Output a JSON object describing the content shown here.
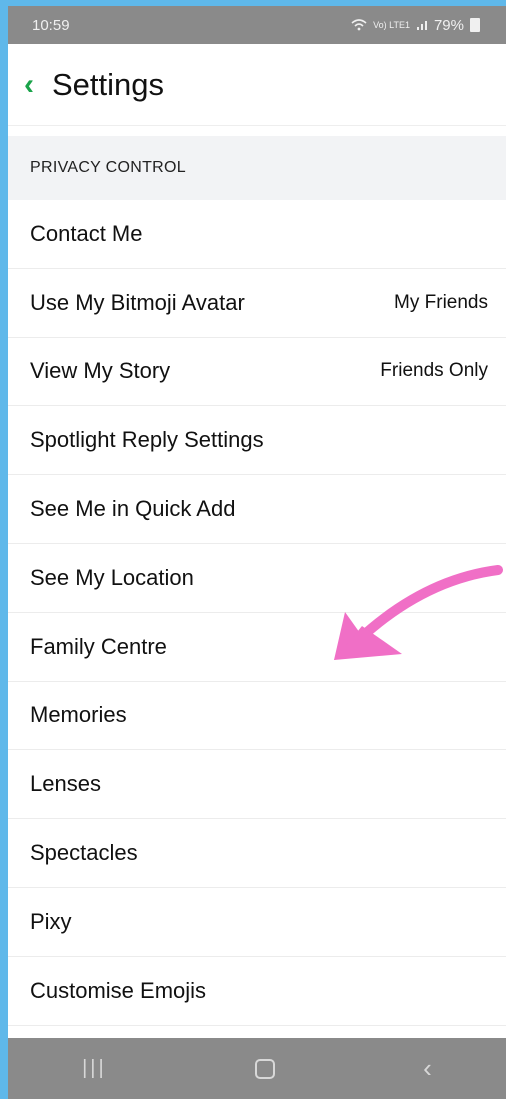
{
  "status_bar": {
    "time": "10:59",
    "network": "Vo) LTE1",
    "battery": "79%"
  },
  "header": {
    "back_icon": "chevron-left-icon",
    "title": "Settings"
  },
  "section": {
    "title": "PRIVACY CONTROL"
  },
  "rows": [
    {
      "label": "Contact Me",
      "value": ""
    },
    {
      "label": "Use My Bitmoji Avatar",
      "value": "My Friends"
    },
    {
      "label": "View My Story",
      "value": "Friends Only"
    },
    {
      "label": "Spotlight Reply Settings",
      "value": ""
    },
    {
      "label": "See Me in Quick Add",
      "value": ""
    },
    {
      "label": "See My Location",
      "value": ""
    },
    {
      "label": "Family Centre",
      "value": ""
    },
    {
      "label": "Memories",
      "value": ""
    },
    {
      "label": "Lenses",
      "value": ""
    },
    {
      "label": "Spectacles",
      "value": ""
    },
    {
      "label": "Pixy",
      "value": ""
    },
    {
      "label": "Customise Emojis",
      "value": ""
    }
  ],
  "nav": {
    "recent_icon": "recent-apps-icon",
    "home_icon": "home-icon",
    "back_icon": "back-icon"
  },
  "colors": {
    "accent": "#1aa34a",
    "annotation_arrow": "#f06fc6",
    "frame": "#5fb8ea"
  }
}
